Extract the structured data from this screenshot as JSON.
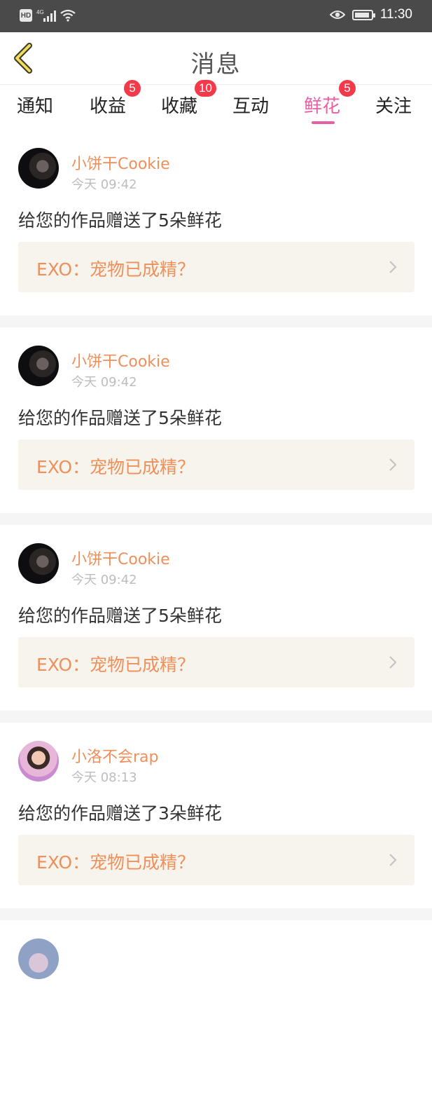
{
  "status_bar": {
    "hd": "HD",
    "network": "4G",
    "time": "11:30",
    "icons": [
      "hd-icon",
      "signal-icon",
      "wifi-icon",
      "eye-icon",
      "battery-icon"
    ]
  },
  "header": {
    "title": "消息",
    "back_icon": "chevron-left-icon"
  },
  "tabs": [
    {
      "label": "通知"
    },
    {
      "label": "收益",
      "badge": "5"
    },
    {
      "label": "收藏",
      "badge": "10"
    },
    {
      "label": "互动"
    },
    {
      "label": "鲜花",
      "badge": "5",
      "active": true
    },
    {
      "label": "关注"
    }
  ],
  "notifications": [
    {
      "username": "小饼干Cookie",
      "time": "今天 09:42",
      "message": "给您的作品赠送了5朵鲜花",
      "work_title": "EXO：宠物已成精？"
    },
    {
      "username": "小饼干Cookie",
      "time": "今天 09:42",
      "message": "给您的作品赠送了5朵鲜花",
      "work_title": "EXO：宠物已成精？"
    },
    {
      "username": "小饼干Cookie",
      "time": "今天 09:42",
      "message": "给您的作品赠送了5朵鲜花",
      "work_title": "EXO：宠物已成精？"
    },
    {
      "username": "小洛不会rap",
      "time": "今天 08:13",
      "message": "给您的作品赠送了3朵鲜花",
      "work_title": "EXO：宠物已成精？"
    }
  ],
  "colors": {
    "accent_pink": "#e85fa3",
    "username_orange": "#ef8f5a",
    "badge_red": "#f23a4b",
    "link_bg": "#f6f4ec"
  }
}
